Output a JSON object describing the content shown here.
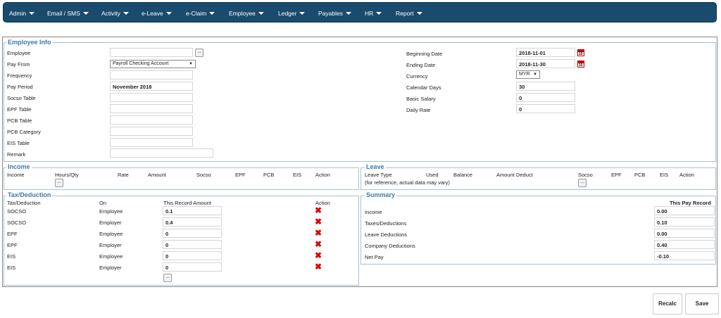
{
  "nav": [
    "Admin",
    "Email / SMS",
    "Activity",
    "e-Leave",
    "e-Claim",
    "Employee",
    "Ledger",
    "Payables",
    "HR",
    "Report"
  ],
  "employee_info": {
    "legend": "Employee Info",
    "labels": {
      "employee": "Employee",
      "pay_from": "Pay From",
      "frequency": "Frequency",
      "pay_period": "Pay Period",
      "socso_table": "Socso Table",
      "epf_table": "EPF Table",
      "pcb_table": "PCB Table",
      "pcb_category": "PCB Category",
      "eis_table": "EIS Table",
      "remark": "Remark",
      "beginning_date": "Beginning Date",
      "ending_date": "Ending Date",
      "currency": "Currency",
      "calendar_days": "Calendar Days",
      "basic_salary": "Basic Salary",
      "daily_rate": "Daily Rate"
    },
    "values": {
      "employee": "",
      "pay_from": "Payroll Checking Account",
      "frequency": "",
      "pay_period": "November 2018",
      "socso_table": "",
      "epf_table": "",
      "pcb_table": "",
      "pcb_category": "",
      "eis_table": "",
      "remark": "",
      "beginning_date": "2018-11-01",
      "ending_date": "2018-11-30",
      "currency": "MYR",
      "calendar_days": "30",
      "basic_salary": "0",
      "daily_rate": "0"
    },
    "lookup_label": "...",
    "calendar_icon_text": "10"
  },
  "income": {
    "legend": "Income",
    "columns": [
      "Income",
      "Hours/Qty",
      "Rate",
      "Amount",
      "Socso",
      "EPF",
      "PCB",
      "EIS",
      "Action"
    ],
    "add_label": "..."
  },
  "leave": {
    "legend": "Leave",
    "columns": [
      "Leave Type",
      "Used",
      "Balance",
      "Amount Deduct",
      "Socso",
      "EPF",
      "PCB",
      "EIS",
      "Action"
    ],
    "note": "(for reference, actual data may vary)",
    "add_label": "..."
  },
  "tax": {
    "legend": "Tax/Deduction",
    "columns": [
      "Tax/Deduction",
      "On",
      "This Record Amount",
      "Action"
    ],
    "rows": [
      {
        "name": "SOCSO",
        "on": "Employee",
        "amount": "0.1"
      },
      {
        "name": "SOCSO",
        "on": "Employer",
        "amount": "0.4"
      },
      {
        "name": "EPF",
        "on": "Employee",
        "amount": "0"
      },
      {
        "name": "EPF",
        "on": "Employer",
        "amount": "0"
      },
      {
        "name": "EIS",
        "on": "Employee",
        "amount": "0"
      },
      {
        "name": "EIS",
        "on": "Employer",
        "amount": "0"
      }
    ],
    "delete_glyph": "✖",
    "add_label": "..."
  },
  "summary": {
    "legend": "Summary",
    "header": "This Pay Record",
    "rows": [
      {
        "label": "Income",
        "value": "0.00"
      },
      {
        "label": "Taxes/Deductions",
        "value": "0.10"
      },
      {
        "label": "Leave Deductions",
        "value": "0.00"
      },
      {
        "label": "Company Deductions",
        "value": "0.40"
      },
      {
        "label": "Net Pay",
        "value": "-0.10"
      }
    ]
  },
  "actions": {
    "recalc": "Recalc",
    "save": "Save"
  },
  "colors": {
    "nav_bg": "#1a4b6e",
    "legend": "#3d79b0",
    "delete": "#d00000"
  }
}
